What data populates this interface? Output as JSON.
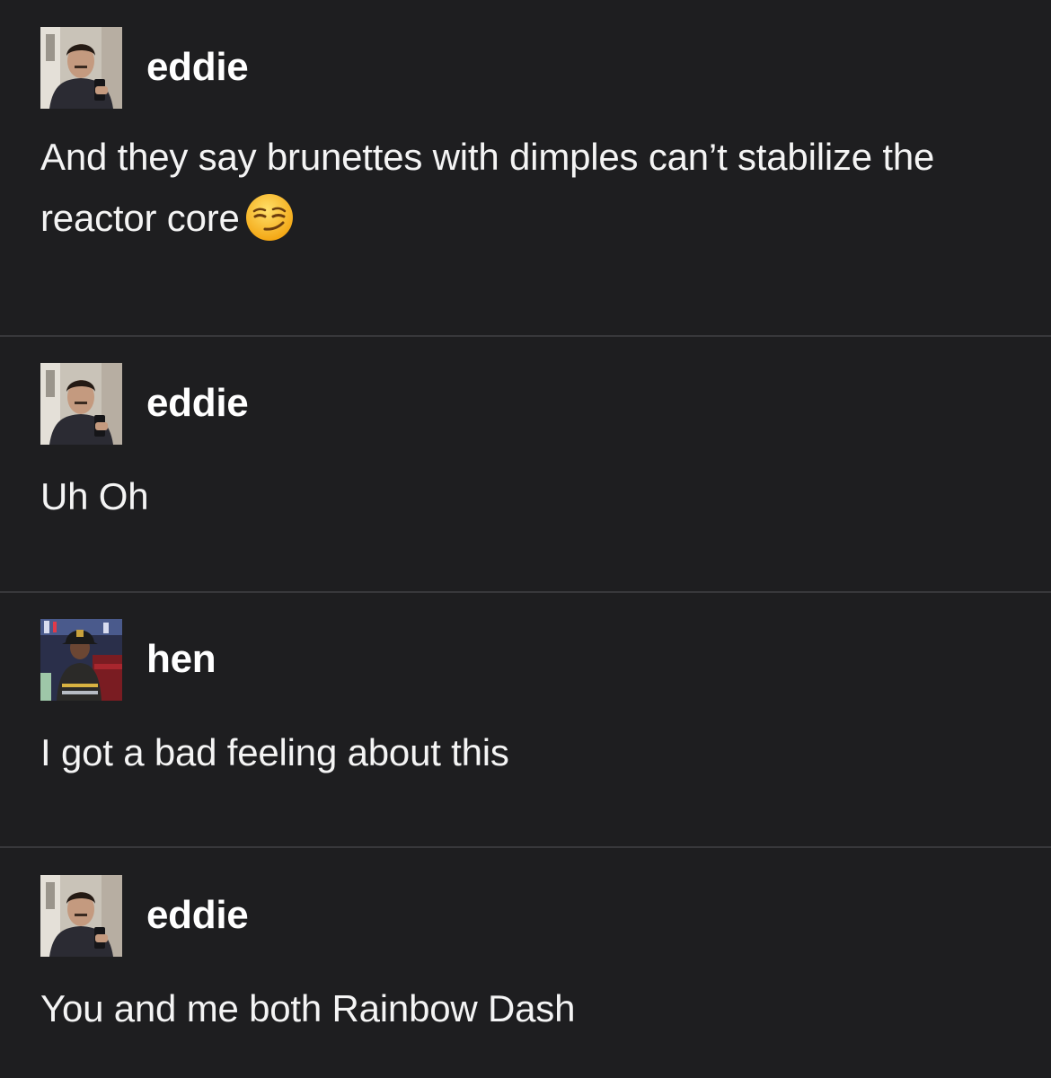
{
  "posts": [
    {
      "username": "eddie",
      "avatar_icon": "man-selfie-avatar",
      "text": "And they say brunettes with dimples can’t stabilize the reactor core",
      "emoji": "smirking-face-emoji"
    },
    {
      "username": "eddie",
      "avatar_icon": "man-selfie-avatar",
      "text": "Uh Oh"
    },
    {
      "username": "hen",
      "avatar_icon": "firefighter-avatar",
      "text": "I got a bad feeling about this"
    },
    {
      "username": "eddie",
      "avatar_icon": "man-selfie-avatar",
      "text": "You and me both Rainbow Dash"
    }
  ],
  "colors": {
    "background": "#1e1e20",
    "divider": "#38383b",
    "text": "#ffffff"
  }
}
